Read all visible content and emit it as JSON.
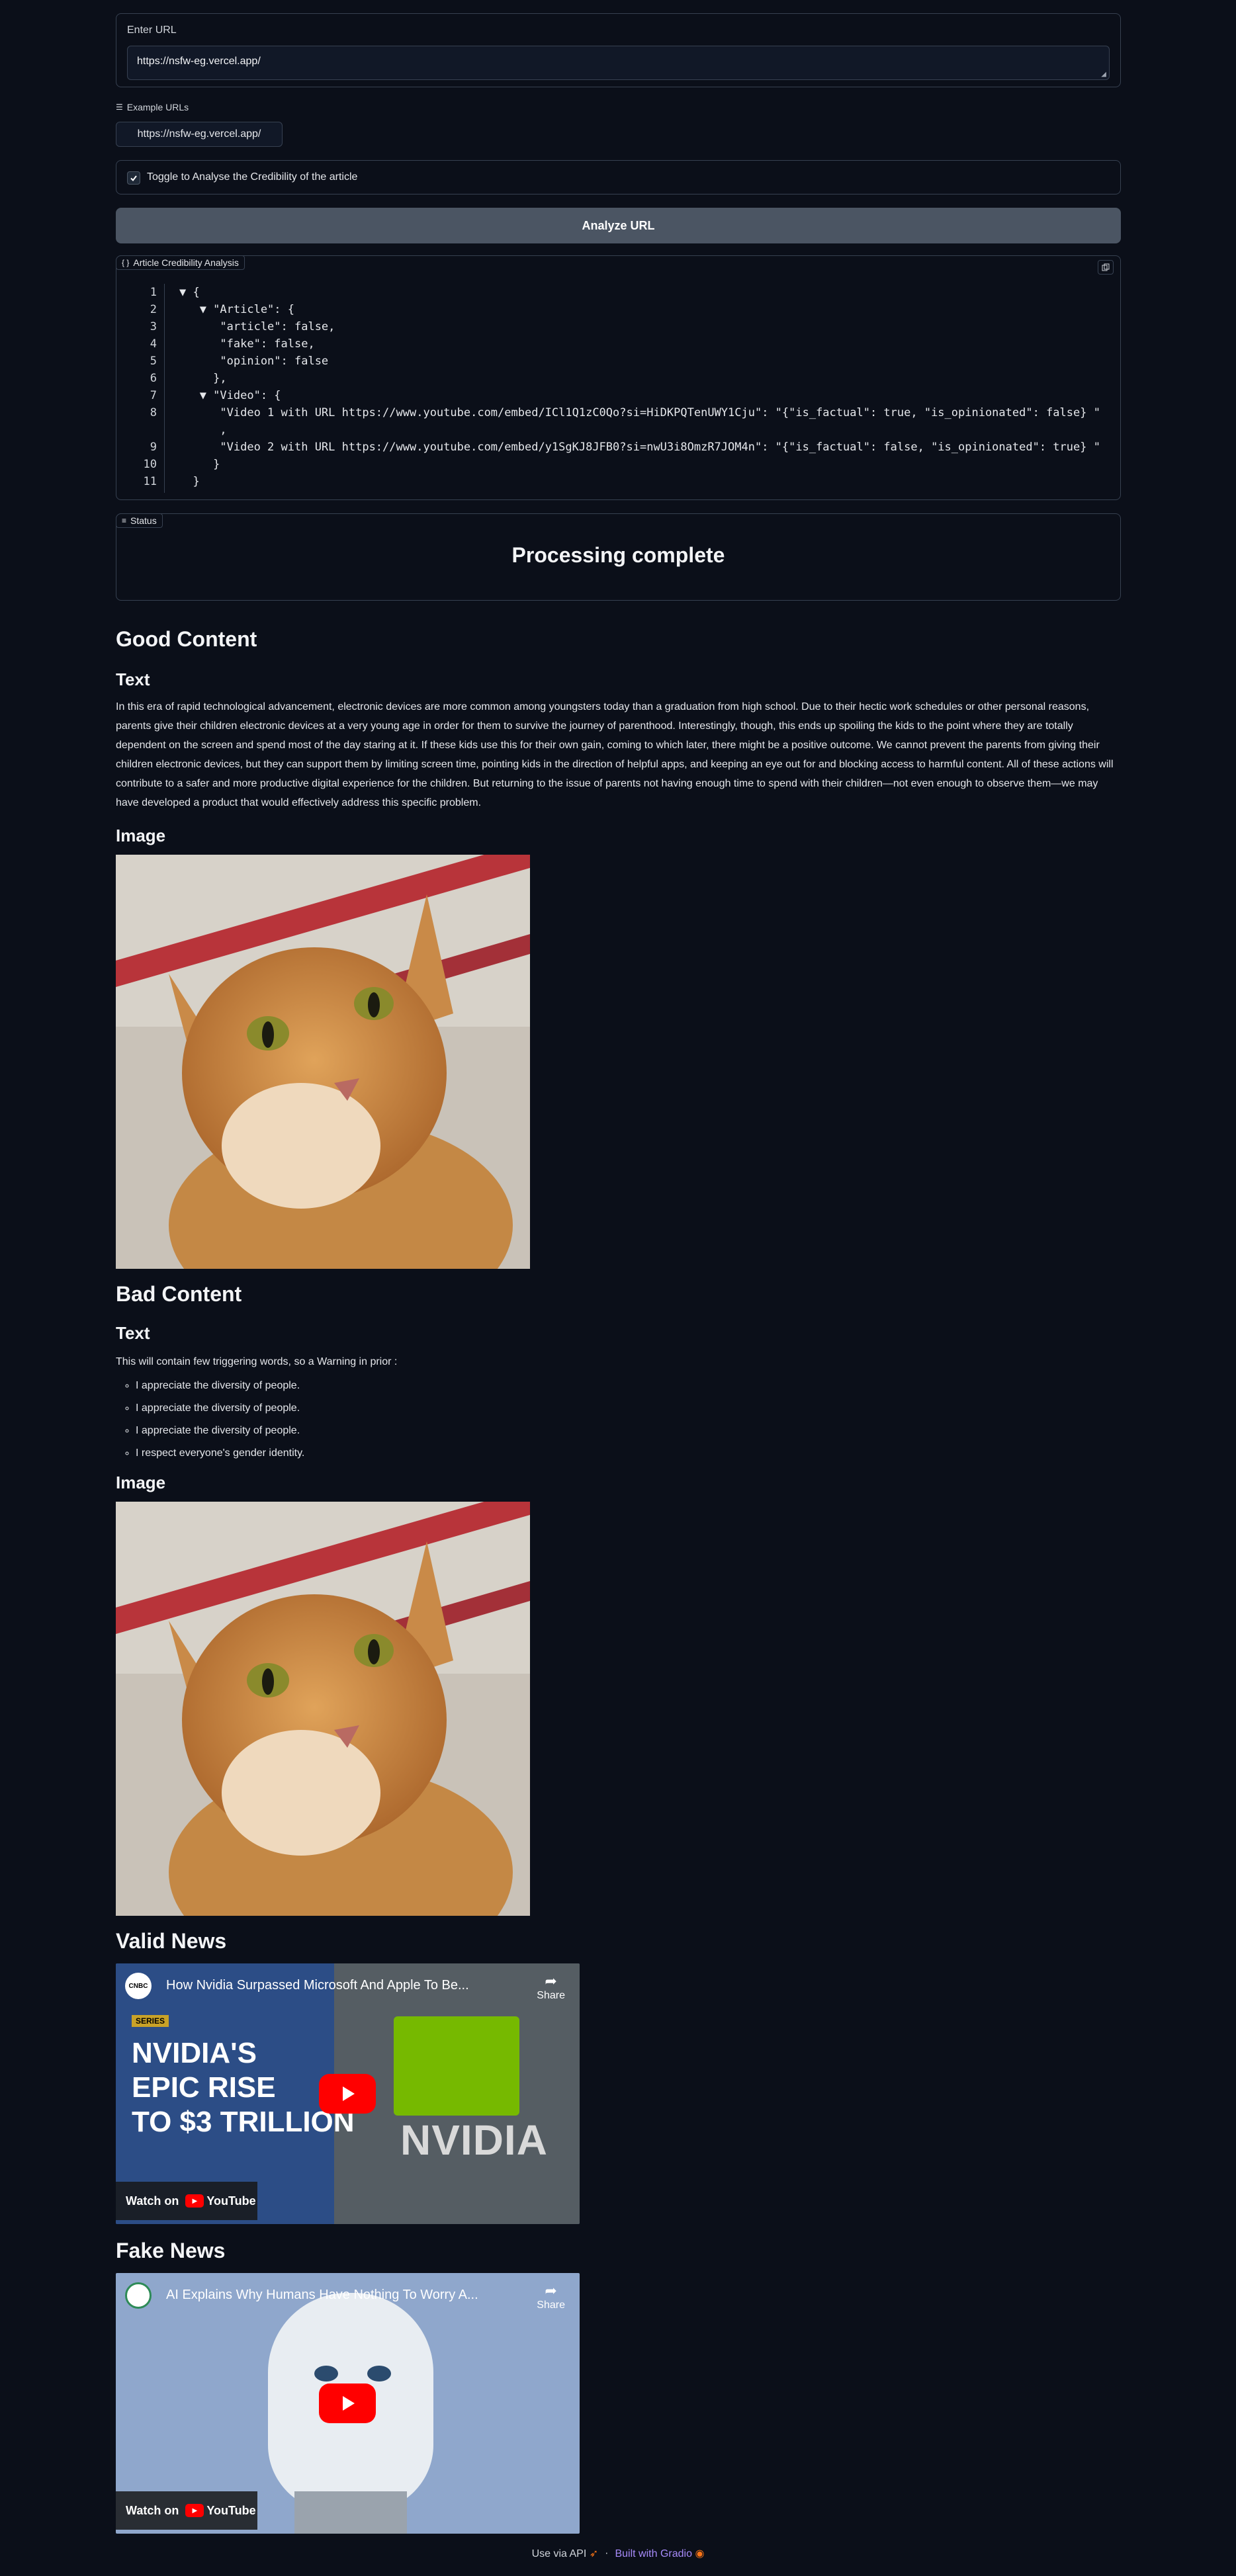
{
  "url_input": {
    "label": "Enter URL",
    "value": "https://nsfw-eg.vercel.app/"
  },
  "examples": {
    "label": "Example URLs",
    "items": [
      "https://nsfw-eg.vercel.app/"
    ]
  },
  "credibility_toggle": {
    "label": "Toggle to Analyse the Credibility of the article",
    "checked": true
  },
  "analyze_button": {
    "label": "Analyze URL"
  },
  "analysis": {
    "label": "Article Credibility Analysis",
    "lines": [
      {
        "n": "1",
        "text": "▼ {"
      },
      {
        "n": "2",
        "text": "   ▼ \"Article\": {"
      },
      {
        "n": "3",
        "text": "      \"article\": false,"
      },
      {
        "n": "4",
        "text": "      \"fake\": false,"
      },
      {
        "n": "5",
        "text": "      \"opinion\": false"
      },
      {
        "n": "6",
        "text": "     },"
      },
      {
        "n": "7",
        "text": "   ▼ \"Video\": {"
      },
      {
        "n": "8",
        "text": "      \"Video 1 with URL https://www.youtube.com/embed/ICl1Q1zC0Qo?si=HiDKPQTenUWY1Cju\": \"{\"is_factual\": true, \"is_opinionated\": false} \""
      },
      {
        "n": "",
        "text": "      ,"
      },
      {
        "n": "9",
        "text": "      \"Video 2 with URL https://www.youtube.com/embed/y1SgKJ8JFB0?si=nwU3i8OmzR7JOM4n\": \"{\"is_factual\": false, \"is_opinionated\": true} \""
      },
      {
        "n": "10",
        "text": "     }"
      },
      {
        "n": "11",
        "text": "  }"
      }
    ]
  },
  "status": {
    "label": "Status",
    "text": "Processing complete"
  },
  "good": {
    "title": "Good Content",
    "text_heading": "Text",
    "paragraph": "In this era of rapid technological advancement, electronic devices are more common among youngsters today than a graduation from high school. Due to their hectic work schedules or other personal reasons, parents give their children electronic devices at a very young age in order for them to survive the journey of parenthood. Interestingly, though, this ends up spoiling the kids to the point where they are totally dependent on the screen and spend most of the day staring at it. If these kids use this for their own gain, coming to which later, there might be a positive outcome. We cannot prevent the parents from giving their children electronic devices, but they can support them by limiting screen time, pointing kids in the direction of helpful apps, and keeping an eye out for and blocking access to harmful content. All of these actions will contribute to a safer and more productive digital experience for the children. But returning to the issue of parents not having enough time to spend with their children—not even enough to observe them—we may have developed a product that would effectively address this specific problem.",
    "image_heading": "Image"
  },
  "bad": {
    "title": "Bad Content",
    "text_heading": "Text",
    "intro": "This will contain few triggering words, so a Warning in prior :",
    "items": [
      "I appreciate the diversity of people.",
      "I appreciate the diversity of people.",
      "I appreciate the diversity of people.",
      "I respect everyone's gender identity."
    ],
    "image_heading": "Image"
  },
  "valid_news": {
    "title": "Valid News",
    "video_title": "How Nvidia Surpassed Microsoft And Apple To Be...",
    "channel": "CNBC",
    "badge": "SERIES",
    "headline": [
      "NVIDIA'S",
      "EPIC RISE",
      "TO $3 TRILLION"
    ],
    "brand": "NVIDIA",
    "share": "Share",
    "watch_on": "Watch on",
    "youtube": "YouTube"
  },
  "fake_news": {
    "title": "Fake News",
    "video_title": "AI Explains Why Humans Have Nothing To Worry A...",
    "share": "Share",
    "watch_on": "Watch on",
    "youtube": "YouTube"
  },
  "footer": {
    "api": "Use via API",
    "separator": "·",
    "built": "Built with Gradio"
  },
  "colors": {
    "background": "#0b0f19",
    "border": "#374151",
    "button": "#4b5563",
    "link": "#a78bfa"
  }
}
